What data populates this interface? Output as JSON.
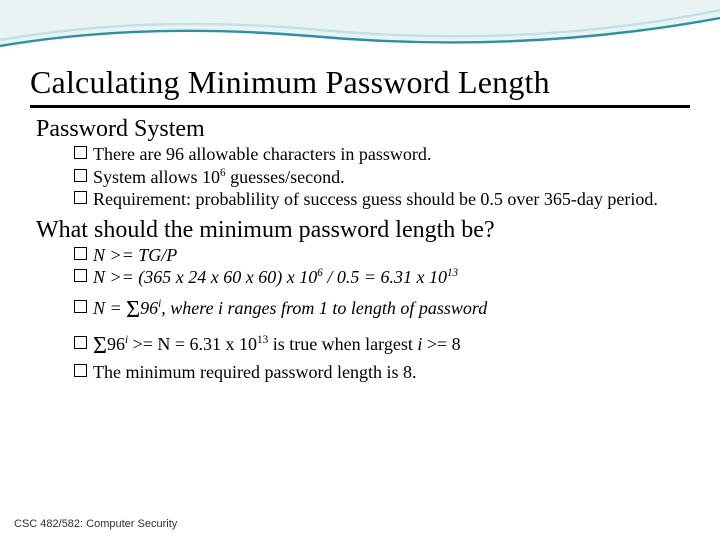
{
  "title": "Calculating Minimum Password Length",
  "sections": {
    "s1": "Password System",
    "s2": "What should the minimum password length be?"
  },
  "b": {
    "a1": "There are 96 allowable characters in password.",
    "a2_pre": "System allows 10",
    "a2_sup": "6",
    "a2_post": " guesses/second.",
    "a3": "Requirement: probablility of success guess should be 0.5 over 365-day period.",
    "c1": "N >= TG/P",
    "c2_pre": "N >= (365 x 24 x 60 x 60) x 10",
    "c2_sup1": "6",
    "c2_mid": " / 0.5 = 6.31 x 10",
    "c2_sup2": "13",
    "c3_pre": "N = ",
    "c3_sum": "Σ",
    "c3_96": "96",
    "c3_sup": "i",
    "c3_post": ", where i ranges from 1 to length of password",
    "c4_sum": "Σ",
    "c4_96": "96",
    "c4_sup": "i",
    "c4_mid": " >= N = 6.31 x 10",
    "c4_sup2": "13",
    "c4_post1": " is true when largest ",
    "c4_i": "i",
    "c4_post2": " >= 8",
    "c5": "The minimum required password length is 8."
  },
  "footer": "CSC 482/582: Computer Security"
}
